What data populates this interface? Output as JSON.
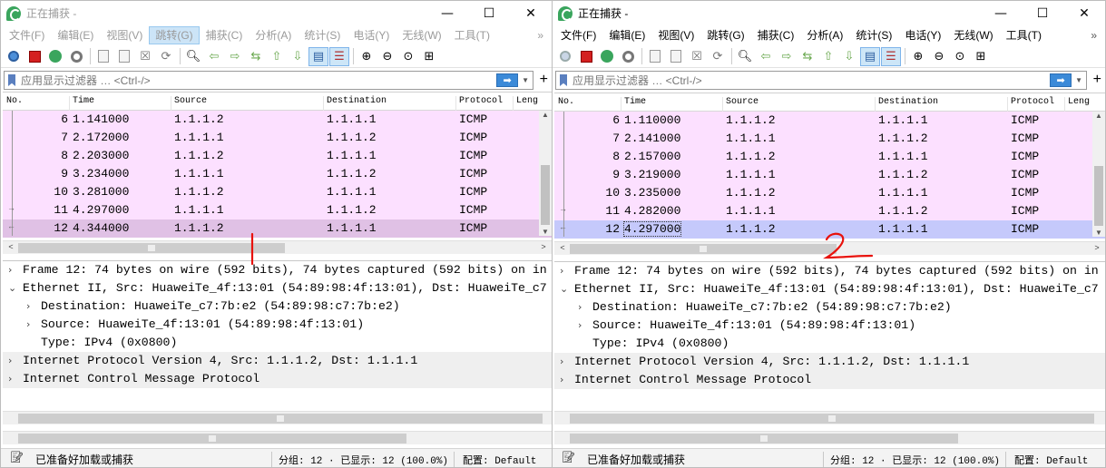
{
  "windows": [
    {
      "title": "正在捕获 -",
      "window_buttons": [
        "—",
        "☐",
        "✕"
      ],
      "menu": [
        "文件(F)",
        "编辑(E)",
        "视图(V)",
        "跳转(G)",
        "捕获(C)",
        "分析(A)",
        "统计(S)",
        "电话(Y)",
        "无线(W)",
        "工具(T)"
      ],
      "menu_selected": "跳转(G)",
      "filter": {
        "placeholder": "应用显示过滤器 … <Ctrl-/>",
        "apply_arrow": "➡",
        "add": "+"
      },
      "columns": [
        "No.",
        "Time",
        "Source",
        "Destination",
        "Protocol",
        "Leng"
      ],
      "packets": [
        {
          "no": "6",
          "time": "1.141000",
          "src": "1.1.1.2",
          "dst": "1.1.1.1",
          "proto": "ICMP"
        },
        {
          "no": "7",
          "time": "2.172000",
          "src": "1.1.1.1",
          "dst": "1.1.1.2",
          "proto": "ICMP"
        },
        {
          "no": "8",
          "time": "2.203000",
          "src": "1.1.1.2",
          "dst": "1.1.1.1",
          "proto": "ICMP"
        },
        {
          "no": "9",
          "time": "3.234000",
          "src": "1.1.1.1",
          "dst": "1.1.1.2",
          "proto": "ICMP"
        },
        {
          "no": "10",
          "time": "3.281000",
          "src": "1.1.1.2",
          "dst": "1.1.1.1",
          "proto": "ICMP"
        },
        {
          "no": "11",
          "time": "4.297000",
          "src": "1.1.1.1",
          "dst": "1.1.1.2",
          "proto": "ICMP"
        },
        {
          "no": "12",
          "time": "4.344000",
          "src": "1.1.1.2",
          "dst": "1.1.1.1",
          "proto": "ICMP"
        }
      ],
      "details": [
        {
          "arrow": "›",
          "text": "Frame 12: 74 bytes on wire (592 bits), 74 bytes captured (592 bits) on in"
        },
        {
          "arrow": "⌄",
          "text": "Ethernet II, Src: HuaweiTe_4f:13:01 (54:89:98:4f:13:01), Dst: HuaweiTe_c7"
        },
        {
          "arrow": "›",
          "text": "Destination: HuaweiTe_c7:7b:e2 (54:89:98:c7:7b:e2)"
        },
        {
          "arrow": "›",
          "text": "Source: HuaweiTe_4f:13:01 (54:89:98:4f:13:01)"
        },
        {
          "arrow": "",
          "text": "Type: IPv4 (0x0800)"
        },
        {
          "arrow": "›",
          "text": "Internet Protocol Version 4, Src: 1.1.1.2, Dst: 1.1.1.1"
        },
        {
          "arrow": "›",
          "text": "Internet Control Message Protocol"
        }
      ],
      "status": {
        "ready": "已准备好加载或捕获",
        "packets": "分组: 12 · 已显示: 12 (100.0%)",
        "profile": "配置: Default"
      }
    },
    {
      "title": "正在捕获 -",
      "window_buttons": [
        "—",
        "☐",
        "✕"
      ],
      "menu": [
        "文件(F)",
        "编辑(E)",
        "视图(V)",
        "跳转(G)",
        "捕获(C)",
        "分析(A)",
        "统计(S)",
        "电话(Y)",
        "无线(W)",
        "工具(T)"
      ],
      "menu_selected": "",
      "filter": {
        "placeholder": "应用显示过滤器 … <Ctrl-/>",
        "apply_arrow": "➡",
        "add": "+"
      },
      "columns": [
        "No.",
        "Time",
        "Source",
        "Destination",
        "Protocol",
        "Leng"
      ],
      "packets": [
        {
          "no": "6",
          "time": "1.110000",
          "src": "1.1.1.2",
          "dst": "1.1.1.1",
          "proto": "ICMP"
        },
        {
          "no": "7",
          "time": "2.141000",
          "src": "1.1.1.1",
          "dst": "1.1.1.2",
          "proto": "ICMP"
        },
        {
          "no": "8",
          "time": "2.157000",
          "src": "1.1.1.2",
          "dst": "1.1.1.1",
          "proto": "ICMP"
        },
        {
          "no": "9",
          "time": "3.219000",
          "src": "1.1.1.1",
          "dst": "1.1.1.2",
          "proto": "ICMP"
        },
        {
          "no": "10",
          "time": "3.235000",
          "src": "1.1.1.2",
          "dst": "1.1.1.1",
          "proto": "ICMP"
        },
        {
          "no": "11",
          "time": "4.282000",
          "src": "1.1.1.1",
          "dst": "1.1.1.2",
          "proto": "ICMP"
        },
        {
          "no": "12",
          "time": "4.297000",
          "src": "1.1.1.2",
          "dst": "1.1.1.1",
          "proto": "ICMP"
        }
      ],
      "details": [
        {
          "arrow": "›",
          "text": "Frame 12: 74 bytes on wire (592 bits), 74 bytes captured (592 bits) on in"
        },
        {
          "arrow": "⌄",
          "text": "Ethernet II, Src: HuaweiTe_4f:13:01 (54:89:98:4f:13:01), Dst: HuaweiTe_c7"
        },
        {
          "arrow": "›",
          "text": "Destination: HuaweiTe_c7:7b:e2 (54:89:98:c7:7b:e2)"
        },
        {
          "arrow": "›",
          "text": "Source: HuaweiTe_4f:13:01 (54:89:98:4f:13:01)"
        },
        {
          "arrow": "",
          "text": "Type: IPv4 (0x0800)"
        },
        {
          "arrow": "›",
          "text": "Internet Protocol Version 4, Src: 1.1.1.2, Dst: 1.1.1.1"
        },
        {
          "arrow": "›",
          "text": "Internet Control Message Protocol"
        }
      ],
      "status": {
        "ready": "已准备好加载或捕获",
        "packets": "分组: 12 · 已显示: 12 (100.0%)",
        "profile": "配置: Default"
      }
    }
  ],
  "colors": {
    "row_bg": "#fce0ff",
    "selected_row_inactive": "#e0c1e5",
    "selected_row_active": "#c5c9fb",
    "annotation": "#e8120c"
  }
}
